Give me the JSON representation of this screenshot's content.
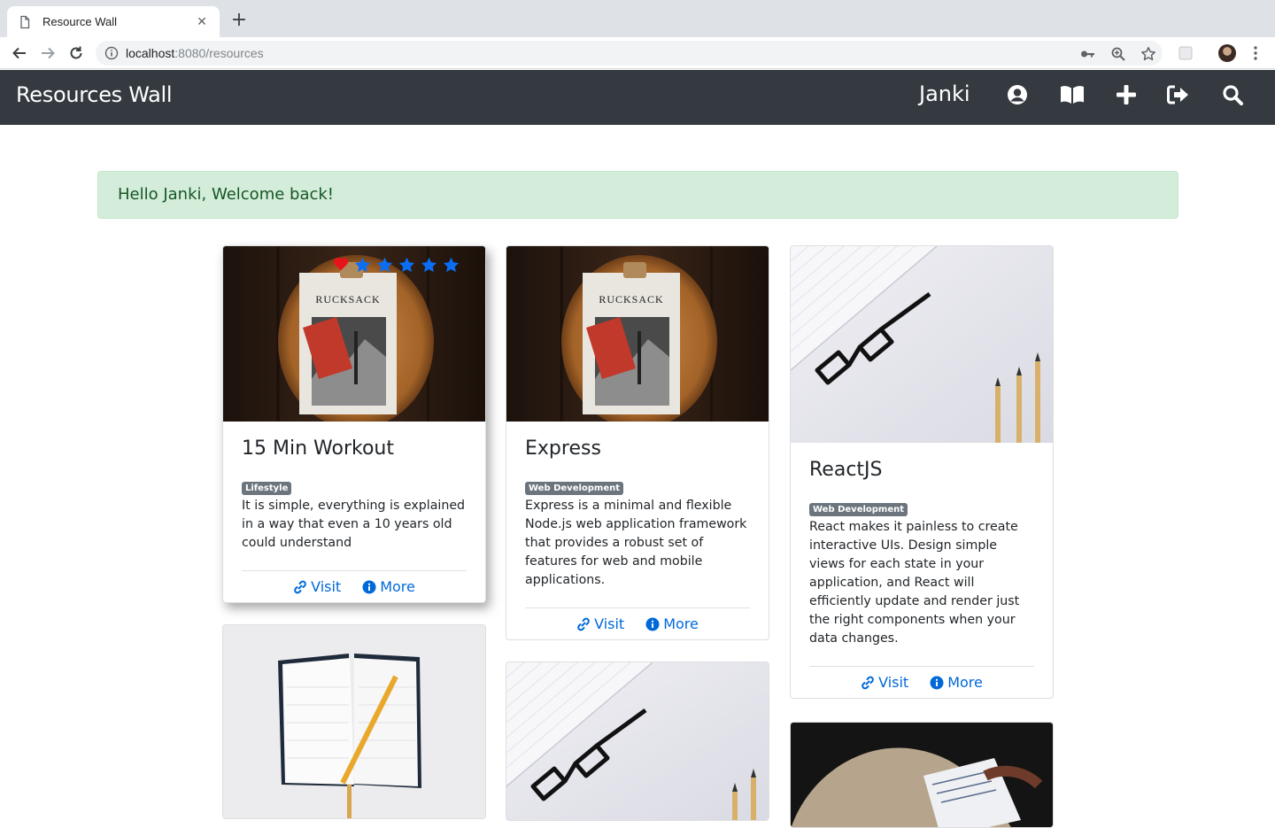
{
  "browser": {
    "tab_title": "Resource Wall",
    "url_host": "localhost",
    "url_rest": ":8080/resources"
  },
  "navbar": {
    "brand": "Resources Wall",
    "username": "Janki"
  },
  "alert": {
    "message": "Hello Janki, Welcome back!"
  },
  "cards": [
    {
      "title": "15 Min Workout",
      "category": "Lifestyle",
      "description": "It is simple, everything is explained in a way that even a 10 years old could understand",
      "visit_label": "Visit",
      "more_label": "More",
      "image": "rucksack-clipboard",
      "liked": true,
      "rating": 5
    },
    {
      "title": "Express",
      "category": "Web Development",
      "description": "Express is a minimal and flexible Node.js web application framework that provides a robust set of features for web and mobile applications.",
      "visit_label": "Visit",
      "more_label": "More",
      "image": "rucksack-clipboard"
    },
    {
      "title": "ReactJS",
      "category": "Web Development",
      "description": "React makes it painless to create interactive UIs. Design simple views for each state in your application, and React will efficiently update and render just the right components when your data changes.",
      "visit_label": "Visit",
      "more_label": "More",
      "image": "glasses-pencils"
    },
    {
      "image": "open-notebook"
    },
    {
      "image": "glasses-pencils"
    },
    {
      "image": "hand-writing"
    }
  ],
  "colors": {
    "navbar": "#343a40",
    "link": "#0069d9",
    "alert_bg": "#d4edda",
    "alert_text": "#155724",
    "badge": "#6c757d",
    "heart": "#e8141b",
    "star": "#0a6ef5"
  }
}
